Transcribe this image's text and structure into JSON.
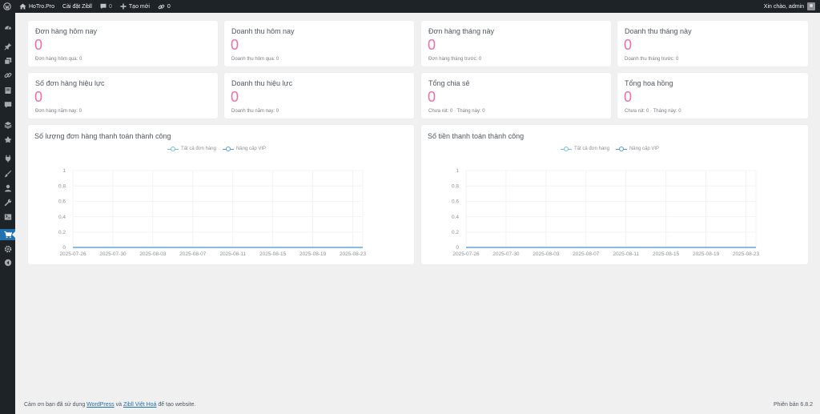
{
  "adminbar": {
    "site_name": "HoTro.Pro",
    "settings_label": "Cài đặt Zibll",
    "comments_count": "0",
    "new_label": "Tạo mới",
    "links_count": "0",
    "greeting": "Xin chào, admin"
  },
  "sidebar": {
    "items": [
      {
        "icon": "dashboard-icon"
      },
      {
        "icon": "pin-icon"
      },
      {
        "icon": "media-icon"
      },
      {
        "icon": "links-icon"
      },
      {
        "icon": "pages-icon"
      },
      {
        "icon": "comments-icon"
      },
      {
        "icon": "layers-icon"
      },
      {
        "icon": "theme-settings-icon"
      },
      {
        "icon": "plugins-icon"
      },
      {
        "icon": "appearance-icon"
      },
      {
        "icon": "users-icon"
      },
      {
        "icon": "tools-icon"
      },
      {
        "icon": "settings-icon"
      },
      {
        "icon": "shop-cart-icon",
        "active": true
      },
      {
        "icon": "gear-icon"
      },
      {
        "icon": "circle-arrow-icon"
      }
    ]
  },
  "stats": [
    {
      "title": "Đơn hàng hôm nay",
      "value": "0",
      "sub": "Đơn hàng hôm qua: 0"
    },
    {
      "title": "Doanh thu hôm nay",
      "value": "0",
      "sub": "Doanh thu hôm qua: 0"
    },
    {
      "title": "Đơn hàng tháng này",
      "value": "0",
      "sub": "Đơn hàng tháng trước: 0"
    },
    {
      "title": "Doanh thu tháng này",
      "value": "0",
      "sub": "Doanh thu tháng trước: 0"
    },
    {
      "title": "Số đơn hàng hiệu lực",
      "value": "0",
      "sub": "Đơn hàng năm nay: 0"
    },
    {
      "title": "Doanh thu hiệu lực",
      "value": "0",
      "sub": "Doanh thu năm nay: 0"
    },
    {
      "title": "Tổng chia sẻ",
      "value": "0",
      "sub": "Chưa rút: 0 · Tháng này: 0"
    },
    {
      "title": "Tổng hoa hồng",
      "value": "0",
      "sub": "Chưa rút: 0 · Tháng này: 0"
    }
  ],
  "colors": {
    "accent_value": "#f06da5",
    "series_all": "#73c0de",
    "series_vip": "#5b9bd5",
    "active_menu": "#2271b1"
  },
  "chart_data": [
    {
      "type": "line",
      "title": "Số lượng đơn hàng thanh toán thành công",
      "x": [
        "2025-07-26",
        "2025-07-27",
        "2025-07-28",
        "2025-07-29",
        "2025-07-30",
        "2025-07-31",
        "2025-08-01",
        "2025-08-02",
        "2025-08-03",
        "2025-08-04",
        "2025-08-05",
        "2025-08-06",
        "2025-08-07",
        "2025-08-08",
        "2025-08-09",
        "2025-08-10",
        "2025-08-11",
        "2025-08-12",
        "2025-08-13",
        "2025-08-14",
        "2025-08-15",
        "2025-08-16",
        "2025-08-17",
        "2025-08-18",
        "2025-08-19",
        "2025-08-20",
        "2025-08-21",
        "2025-08-22",
        "2025-08-23",
        "2025-08-24"
      ],
      "x_tick_labels": [
        "2025-07-26",
        "2025-07-30",
        "2025-08-03",
        "2025-08-07",
        "2025-08-11",
        "2025-08-15",
        "2025-08-19",
        "2025-08-23"
      ],
      "series": [
        {
          "name": "Tất cả đơn hàng",
          "values": [
            0,
            0,
            0,
            0,
            0,
            0,
            0,
            0,
            0,
            0,
            0,
            0,
            0,
            0,
            0,
            0,
            0,
            0,
            0,
            0,
            0,
            0,
            0,
            0,
            0,
            0,
            0,
            0,
            0,
            0
          ]
        },
        {
          "name": "Nâng cấp VIP",
          "values": [
            0,
            0,
            0,
            0,
            0,
            0,
            0,
            0,
            0,
            0,
            0,
            0,
            0,
            0,
            0,
            0,
            0,
            0,
            0,
            0,
            0,
            0,
            0,
            0,
            0,
            0,
            0,
            0,
            0,
            0
          ]
        }
      ],
      "y_ticks": [
        "0",
        "0.2",
        "0.4",
        "0.6",
        "0.8",
        "1"
      ],
      "ylim": [
        0,
        1
      ],
      "grid": true,
      "legend": "top-center"
    },
    {
      "type": "line",
      "title": "Số tiền thanh toán thành công",
      "x": [
        "2025-07-26",
        "2025-07-27",
        "2025-07-28",
        "2025-07-29",
        "2025-07-30",
        "2025-07-31",
        "2025-08-01",
        "2025-08-02",
        "2025-08-03",
        "2025-08-04",
        "2025-08-05",
        "2025-08-06",
        "2025-08-07",
        "2025-08-08",
        "2025-08-09",
        "2025-08-10",
        "2025-08-11",
        "2025-08-12",
        "2025-08-13",
        "2025-08-14",
        "2025-08-15",
        "2025-08-16",
        "2025-08-17",
        "2025-08-18",
        "2025-08-19",
        "2025-08-20",
        "2025-08-21",
        "2025-08-22",
        "2025-08-23",
        "2025-08-24"
      ],
      "x_tick_labels": [
        "2025-07-26",
        "2025-07-30",
        "2025-08-03",
        "2025-08-07",
        "2025-08-11",
        "2025-08-15",
        "2025-08-19",
        "2025-08-23"
      ],
      "series": [
        {
          "name": "Tất cả đơn hàng",
          "values": [
            0,
            0,
            0,
            0,
            0,
            0,
            0,
            0,
            0,
            0,
            0,
            0,
            0,
            0,
            0,
            0,
            0,
            0,
            0,
            0,
            0,
            0,
            0,
            0,
            0,
            0,
            0,
            0,
            0,
            0
          ]
        },
        {
          "name": "Nâng cấp VIP",
          "values": [
            0,
            0,
            0,
            0,
            0,
            0,
            0,
            0,
            0,
            0,
            0,
            0,
            0,
            0,
            0,
            0,
            0,
            0,
            0,
            0,
            0,
            0,
            0,
            0,
            0,
            0,
            0,
            0,
            0,
            0
          ]
        }
      ],
      "y_ticks": [
        "0",
        "0.2",
        "0.4",
        "0.6",
        "0.8",
        "1"
      ],
      "ylim": [
        0,
        1
      ],
      "grid": true,
      "legend": "top-center"
    }
  ],
  "footer": {
    "text_before": "Cảm ơn bạn đã sử dụng ",
    "link_wordpress": "WordPress",
    "text_and": " và ",
    "link_zibll": "Zibll Việt Hoá",
    "text_after": " để tạo website.",
    "version": "Phiên bản 6.8.2"
  }
}
